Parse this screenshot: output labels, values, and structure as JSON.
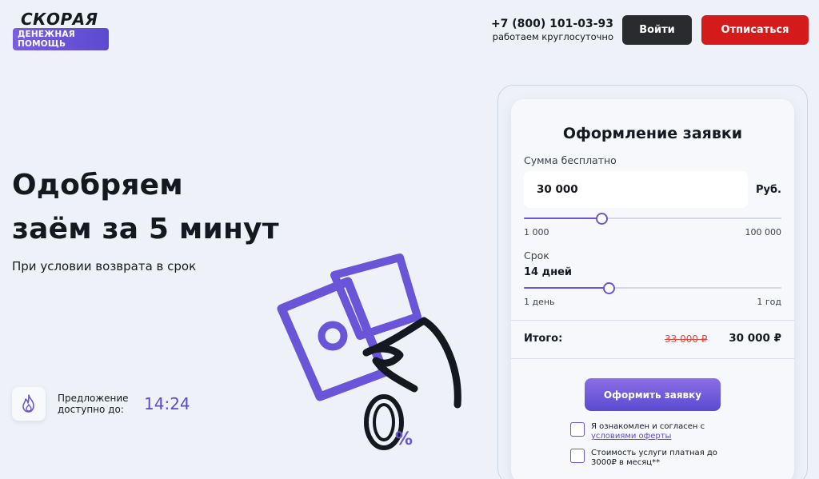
{
  "header": {
    "logo_top": "СКОРАЯ",
    "logo_bottom": "ДЕНЕЖНАЯ ПОМОЩЬ",
    "phone": "+7 (800) 101-03-93",
    "hours": "работаем круглосуточно",
    "login_label": "Войти",
    "unsubscribe_label": "Отписаться"
  },
  "hero": {
    "title_line1": "Одобряем",
    "title_line2": "заём за 5 минут",
    "subtitle": "При условии возврата в срок",
    "offer_text_line1": "Предложение",
    "offer_text_line2": "доступно до:",
    "offer_time": "14:24"
  },
  "form": {
    "title": "Оформление заявки",
    "sum_label": "Сумма бесплатно",
    "sum_value": "30 000",
    "currency": "Руб.",
    "sum_min": "1 000",
    "sum_max": "100 000",
    "sum_slider_fraction": 0.3,
    "term_label": "Срок",
    "term_value": "14 дней",
    "term_min": "1 день",
    "term_max": "1 год",
    "term_slider_fraction": 0.33,
    "total_label": "Итого:",
    "total_old": "33 000 ₽",
    "total_new": "30 000 ₽",
    "submit_label": "Оформить заявку",
    "agree_text": "Я ознакомлен и согласен с",
    "agree_link": "условиями оферты",
    "cost_text": "Стоимость услуги платная до 3000₽ в месяц**"
  },
  "colors": {
    "accent": "#6a55d8",
    "danger": "#d41a1a",
    "dark_button": "#2a2b2e",
    "background": "#eef2f8"
  }
}
